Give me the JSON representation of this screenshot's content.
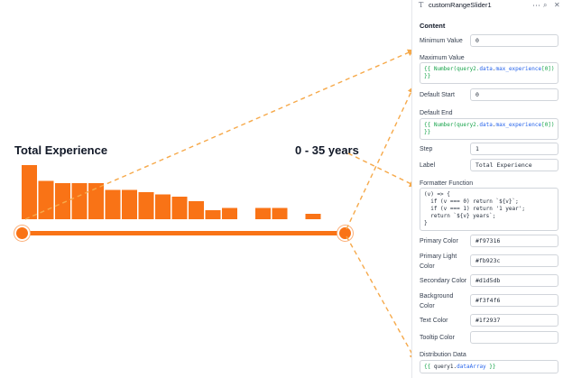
{
  "slider": {
    "title": "Total Experience",
    "range_text": "0 - 35 years",
    "primary_color": "#f97316",
    "light_color": "#fb923c",
    "distribution": [
      12,
      8.5,
      8,
      8,
      8,
      6.5,
      6.5,
      6,
      5.5,
      5,
      4,
      2,
      2.5,
      0,
      2.5,
      2.5,
      0,
      1.2
    ]
  },
  "panel": {
    "component_name": "customRangeSlider1",
    "section_title": "Content",
    "fields": {
      "min_label": "Minimum Value",
      "min_value": "0",
      "max_label": "Maximum Value",
      "max_pre": "{{ Number(query2.",
      "max_data": "data",
      "max_dot": ".",
      "max_prop": "max_experience",
      "max_post": "[0])",
      "max_close": "}}",
      "start_label": "Default Start",
      "start_value": "0",
      "end_label": "Default End",
      "end_pre": "{{ Number(query2.",
      "end_data": "data",
      "end_dot": ".",
      "end_prop": "max_experience",
      "end_post": "[0])",
      "end_close": "}}",
      "step_label": "Step",
      "step_value": "1",
      "label_label": "Label",
      "label_value": "Total Experience",
      "formatter_label": "Formatter Function",
      "formatter_lines": [
        "(v) => {",
        "  if (v === 0) return `${v}`;",
        "  if (v === 1) return '1 year';",
        "  return `${v} years`;",
        "}"
      ],
      "primary_label": "Primary Color",
      "primary_value": "#f97316",
      "primary_light_label": "Primary Light Color",
      "primary_light_value": "#fb923c",
      "secondary_label": "Secondary Color",
      "secondary_value": "#d1d5db",
      "background_label": "Background Color",
      "background_value": "#f3f4f6",
      "text_label": "Text Color",
      "text_value": "#1f2937",
      "tooltip_label": "Tooltip Color",
      "tooltip_value": "",
      "distribution_label": "Distribution Data",
      "dist_pre": "{{ ",
      "dist_obj": "query1",
      "dist_dot": ".",
      "dist_prop": "dataArray",
      "dist_close": " }}"
    }
  },
  "icons": {
    "type": "T",
    "more": "⋯",
    "search": "⌕",
    "close": "✕"
  }
}
